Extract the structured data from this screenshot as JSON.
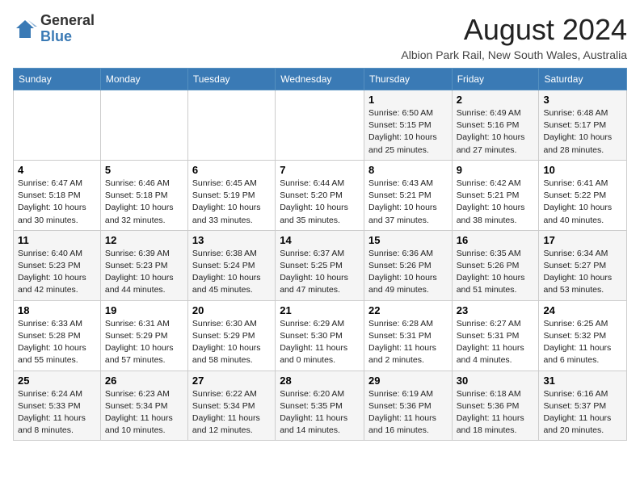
{
  "header": {
    "logo_general": "General",
    "logo_blue": "Blue",
    "month_title": "August 2024",
    "subtitle": "Albion Park Rail, New South Wales, Australia"
  },
  "weekdays": [
    "Sunday",
    "Monday",
    "Tuesday",
    "Wednesday",
    "Thursday",
    "Friday",
    "Saturday"
  ],
  "weeks": [
    [
      {
        "day": "",
        "info": ""
      },
      {
        "day": "",
        "info": ""
      },
      {
        "day": "",
        "info": ""
      },
      {
        "day": "",
        "info": ""
      },
      {
        "day": "1",
        "info": "Sunrise: 6:50 AM\nSunset: 5:15 PM\nDaylight: 10 hours\nand 25 minutes."
      },
      {
        "day": "2",
        "info": "Sunrise: 6:49 AM\nSunset: 5:16 PM\nDaylight: 10 hours\nand 27 minutes."
      },
      {
        "day": "3",
        "info": "Sunrise: 6:48 AM\nSunset: 5:17 PM\nDaylight: 10 hours\nand 28 minutes."
      }
    ],
    [
      {
        "day": "4",
        "info": "Sunrise: 6:47 AM\nSunset: 5:18 PM\nDaylight: 10 hours\nand 30 minutes."
      },
      {
        "day": "5",
        "info": "Sunrise: 6:46 AM\nSunset: 5:18 PM\nDaylight: 10 hours\nand 32 minutes."
      },
      {
        "day": "6",
        "info": "Sunrise: 6:45 AM\nSunset: 5:19 PM\nDaylight: 10 hours\nand 33 minutes."
      },
      {
        "day": "7",
        "info": "Sunrise: 6:44 AM\nSunset: 5:20 PM\nDaylight: 10 hours\nand 35 minutes."
      },
      {
        "day": "8",
        "info": "Sunrise: 6:43 AM\nSunset: 5:21 PM\nDaylight: 10 hours\nand 37 minutes."
      },
      {
        "day": "9",
        "info": "Sunrise: 6:42 AM\nSunset: 5:21 PM\nDaylight: 10 hours\nand 38 minutes."
      },
      {
        "day": "10",
        "info": "Sunrise: 6:41 AM\nSunset: 5:22 PM\nDaylight: 10 hours\nand 40 minutes."
      }
    ],
    [
      {
        "day": "11",
        "info": "Sunrise: 6:40 AM\nSunset: 5:23 PM\nDaylight: 10 hours\nand 42 minutes."
      },
      {
        "day": "12",
        "info": "Sunrise: 6:39 AM\nSunset: 5:23 PM\nDaylight: 10 hours\nand 44 minutes."
      },
      {
        "day": "13",
        "info": "Sunrise: 6:38 AM\nSunset: 5:24 PM\nDaylight: 10 hours\nand 45 minutes."
      },
      {
        "day": "14",
        "info": "Sunrise: 6:37 AM\nSunset: 5:25 PM\nDaylight: 10 hours\nand 47 minutes."
      },
      {
        "day": "15",
        "info": "Sunrise: 6:36 AM\nSunset: 5:26 PM\nDaylight: 10 hours\nand 49 minutes."
      },
      {
        "day": "16",
        "info": "Sunrise: 6:35 AM\nSunset: 5:26 PM\nDaylight: 10 hours\nand 51 minutes."
      },
      {
        "day": "17",
        "info": "Sunrise: 6:34 AM\nSunset: 5:27 PM\nDaylight: 10 hours\nand 53 minutes."
      }
    ],
    [
      {
        "day": "18",
        "info": "Sunrise: 6:33 AM\nSunset: 5:28 PM\nDaylight: 10 hours\nand 55 minutes."
      },
      {
        "day": "19",
        "info": "Sunrise: 6:31 AM\nSunset: 5:29 PM\nDaylight: 10 hours\nand 57 minutes."
      },
      {
        "day": "20",
        "info": "Sunrise: 6:30 AM\nSunset: 5:29 PM\nDaylight: 10 hours\nand 58 minutes."
      },
      {
        "day": "21",
        "info": "Sunrise: 6:29 AM\nSunset: 5:30 PM\nDaylight: 11 hours\nand 0 minutes."
      },
      {
        "day": "22",
        "info": "Sunrise: 6:28 AM\nSunset: 5:31 PM\nDaylight: 11 hours\nand 2 minutes."
      },
      {
        "day": "23",
        "info": "Sunrise: 6:27 AM\nSunset: 5:31 PM\nDaylight: 11 hours\nand 4 minutes."
      },
      {
        "day": "24",
        "info": "Sunrise: 6:25 AM\nSunset: 5:32 PM\nDaylight: 11 hours\nand 6 minutes."
      }
    ],
    [
      {
        "day": "25",
        "info": "Sunrise: 6:24 AM\nSunset: 5:33 PM\nDaylight: 11 hours\nand 8 minutes."
      },
      {
        "day": "26",
        "info": "Sunrise: 6:23 AM\nSunset: 5:34 PM\nDaylight: 11 hours\nand 10 minutes."
      },
      {
        "day": "27",
        "info": "Sunrise: 6:22 AM\nSunset: 5:34 PM\nDaylight: 11 hours\nand 12 minutes."
      },
      {
        "day": "28",
        "info": "Sunrise: 6:20 AM\nSunset: 5:35 PM\nDaylight: 11 hours\nand 14 minutes."
      },
      {
        "day": "29",
        "info": "Sunrise: 6:19 AM\nSunset: 5:36 PM\nDaylight: 11 hours\nand 16 minutes."
      },
      {
        "day": "30",
        "info": "Sunrise: 6:18 AM\nSunset: 5:36 PM\nDaylight: 11 hours\nand 18 minutes."
      },
      {
        "day": "31",
        "info": "Sunrise: 6:16 AM\nSunset: 5:37 PM\nDaylight: 11 hours\nand 20 minutes."
      }
    ]
  ]
}
